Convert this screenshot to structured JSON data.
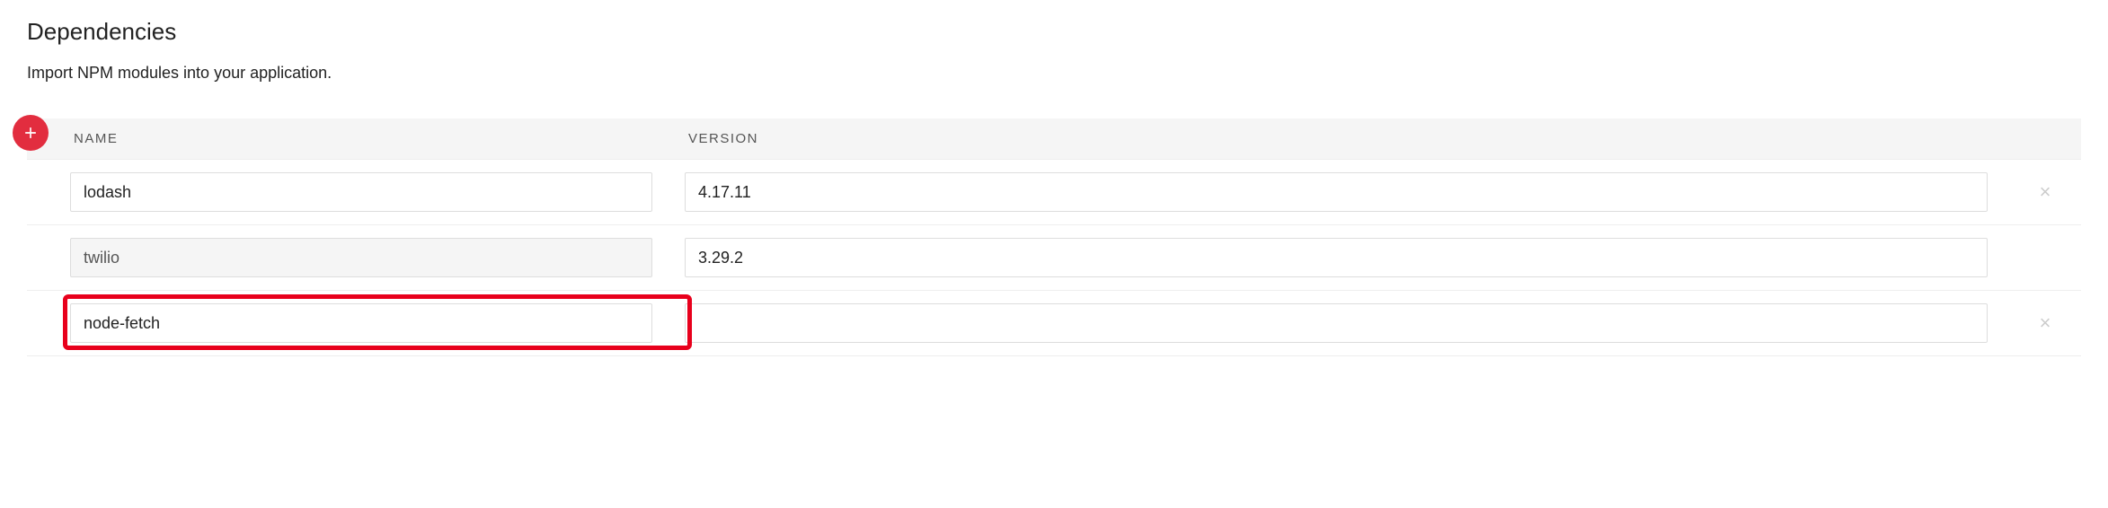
{
  "section": {
    "title": "Dependencies",
    "subtitle": "Import NPM modules into your application."
  },
  "table": {
    "headers": {
      "name": "NAME",
      "version": "VERSION"
    },
    "rows": [
      {
        "name": "lodash",
        "version": "4.17.11",
        "name_readonly": false,
        "deletable": true
      },
      {
        "name": "twilio",
        "version": "3.29.2",
        "name_readonly": true,
        "deletable": false
      },
      {
        "name": "node-fetch",
        "version": "",
        "name_readonly": false,
        "deletable": true,
        "highlighted": true
      }
    ]
  },
  "icons": {
    "plus": "plus-icon",
    "delete": "×"
  }
}
